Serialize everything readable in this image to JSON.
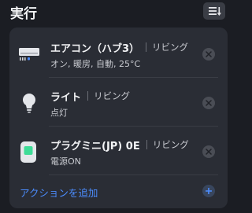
{
  "header": {
    "title": "実行",
    "sort_icon": "sort-list-icon"
  },
  "actions": [
    {
      "device": "エアコン（ハブ3）",
      "room": "リビング",
      "detail": "オン, 暖房, 自動, 25°C",
      "icon": "air-conditioner-icon"
    },
    {
      "device": "ライト",
      "room": "リビング",
      "detail": "点灯",
      "icon": "light-bulb-icon"
    },
    {
      "device": "プラグミニ(JP) 0E",
      "room": "リビング",
      "detail": "電源ON",
      "icon": "smart-plug-icon"
    }
  ],
  "add_action": {
    "label": "アクションを追加",
    "icon": "plus-icon"
  },
  "colors": {
    "background": "#1b1d23",
    "card": "#2a2d35",
    "accent": "#4c8dff",
    "plug_led": "#3ddc97"
  }
}
